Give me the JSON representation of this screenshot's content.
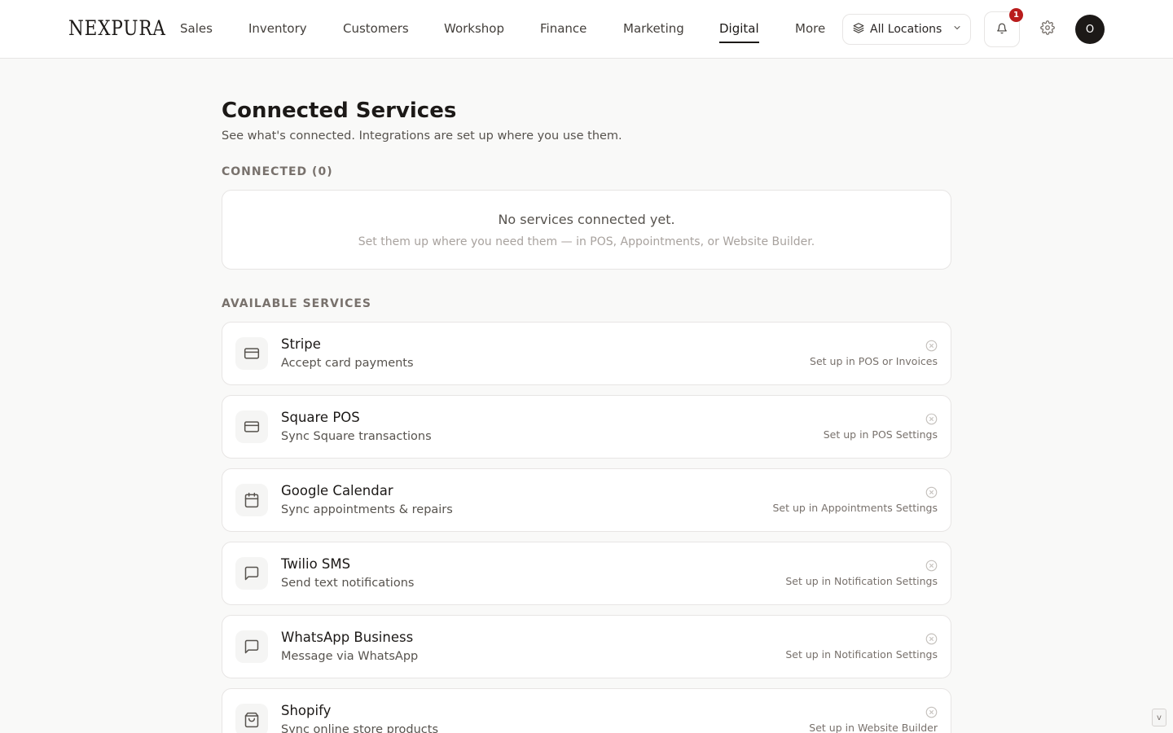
{
  "brand": {
    "logo_text": "NEXPURA"
  },
  "nav": {
    "items": [
      {
        "label": "Sales",
        "active": false
      },
      {
        "label": "Inventory",
        "active": false
      },
      {
        "label": "Customers",
        "active": false
      },
      {
        "label": "Workshop",
        "active": false
      },
      {
        "label": "Finance",
        "active": false
      },
      {
        "label": "Marketing",
        "active": false
      },
      {
        "label": "Digital",
        "active": true
      },
      {
        "label": "More",
        "active": false
      }
    ]
  },
  "header": {
    "location_label": "All Locations",
    "location_icon": "layers-icon",
    "notification_count": "1",
    "avatar_initial": "O"
  },
  "page": {
    "title": "Connected Services",
    "subtitle": "See what's connected. Integrations are set up where you use them."
  },
  "connected": {
    "label": "CONNECTED (0)",
    "empty_title": "No services connected yet.",
    "empty_desc": "Set them up where you need them — in POS, Appointments, or Website Builder."
  },
  "available": {
    "label": "AVAILABLE SERVICES",
    "services": [
      {
        "name": "Stripe",
        "desc": "Accept card payments",
        "hint": "Set up in POS or Invoices",
        "icon": "credit-card-icon"
      },
      {
        "name": "Square POS",
        "desc": "Sync Square transactions",
        "hint": "Set up in POS Settings",
        "icon": "credit-card-icon"
      },
      {
        "name": "Google Calendar",
        "desc": "Sync appointments & repairs",
        "hint": "Set up in Appointments Settings",
        "icon": "calendar-icon"
      },
      {
        "name": "Twilio SMS",
        "desc": "Send text notifications",
        "hint": "Set up in Notification Settings",
        "icon": "message-square-icon"
      },
      {
        "name": "WhatsApp Business",
        "desc": "Message via WhatsApp",
        "hint": "Set up in Notification Settings",
        "icon": "message-square-icon"
      },
      {
        "name": "Shopify",
        "desc": "Sync online store products",
        "hint": "Set up in Website Builder",
        "icon": "shopping-bag-icon"
      }
    ]
  },
  "colors": {
    "accent": "#1c1917",
    "badge": "#b91c1c",
    "background": "#f9f9f8",
    "border": "#e7e5e4"
  },
  "scroll": {
    "label": "v"
  }
}
